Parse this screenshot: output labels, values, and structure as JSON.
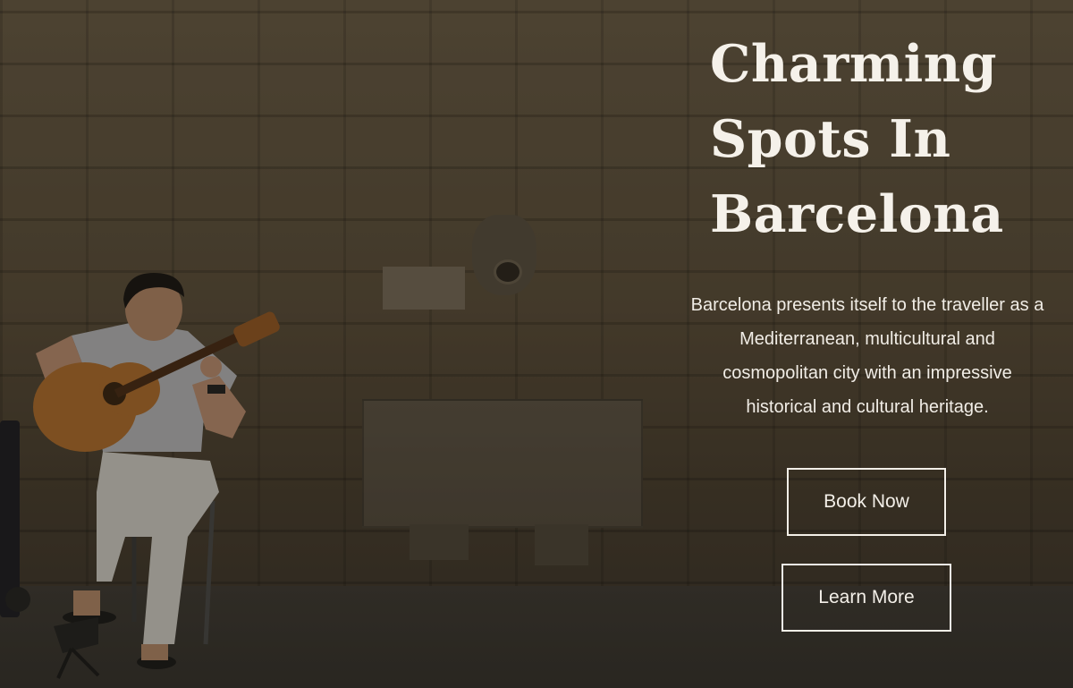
{
  "hero": {
    "title": "Charming Spots In Barcelona",
    "description": "Barcelona presents itself to the traveller as a Mediterranean, multicultural and cosmopolitan city with an impressive historical and cultural heritage.",
    "buttons": {
      "book_label": "Book Now",
      "learn_label": "Learn More"
    },
    "background_image": "street-guitarist-stone-wall-photo"
  },
  "colors": {
    "text": "#f5f1ea",
    "overlay": "#14100a",
    "button_border": "#f3efe8"
  }
}
